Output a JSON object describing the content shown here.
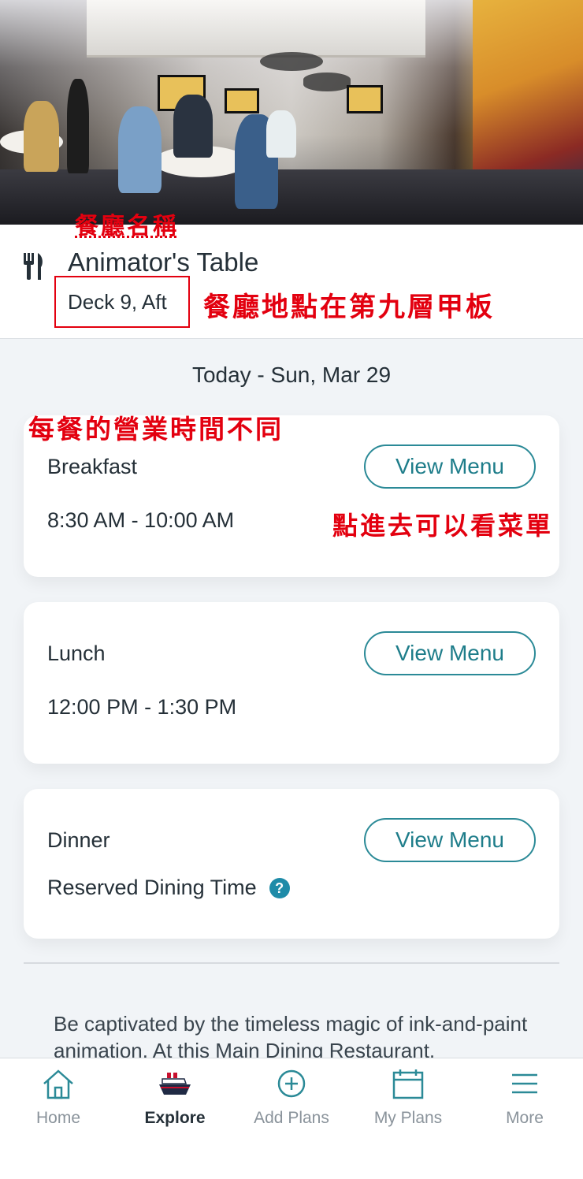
{
  "annotations": {
    "restaurant_name": "餐廳名稱",
    "deck_location": "餐廳地點在第九層甲板",
    "hours_differ": "每餐的營業時間不同",
    "tap_menu": "點進去可以看菜單"
  },
  "restaurant": {
    "name": "Animator's Table",
    "location": "Deck 9, Aft"
  },
  "date_label": "Today - Sun, Mar 29",
  "meals": [
    {
      "name": "Breakfast",
      "hours": "8:30 AM - 10:00 AM",
      "button": "View Menu"
    },
    {
      "name": "Lunch",
      "hours": "12:00 PM - 1:30 PM",
      "button": "View Menu"
    },
    {
      "name": "Dinner",
      "hours": "Reserved Dining Time",
      "button": "View Menu",
      "help": "?"
    }
  ],
  "description": "Be captivated by the timeless magic of ink-and-paint animation. At this Main Dining Restaurant,",
  "tabs": [
    {
      "label": "Home",
      "icon": "home-icon"
    },
    {
      "label": "Explore",
      "icon": "ship-icon",
      "active": true
    },
    {
      "label": "Add Plans",
      "icon": "plus-circle-icon"
    },
    {
      "label": "My Plans",
      "icon": "calendar-icon"
    },
    {
      "label": "More",
      "icon": "menu-icon"
    }
  ],
  "colors": {
    "accent": "#1e7d8a",
    "annotation": "#e3000f",
    "background": "#f1f4f7"
  }
}
